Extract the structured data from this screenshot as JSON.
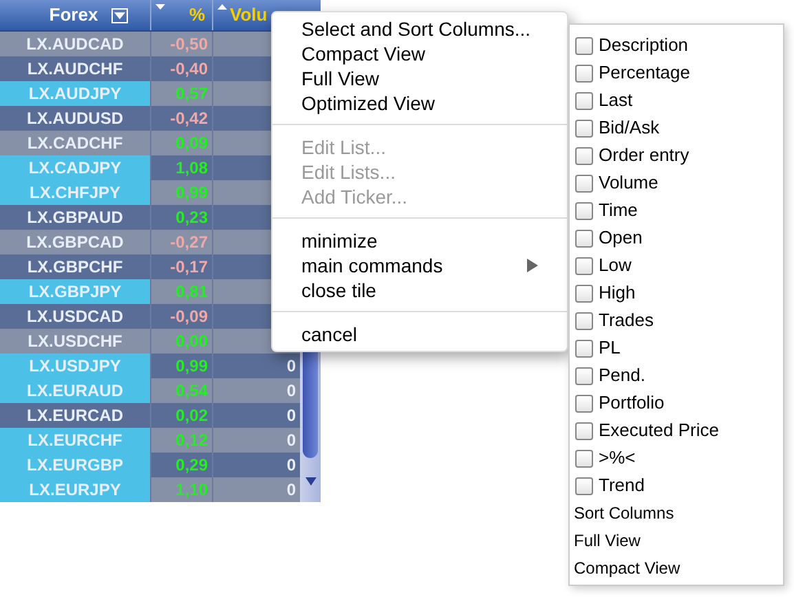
{
  "table": {
    "columns": [
      "Forex",
      "%",
      "Volu"
    ],
    "rows": [
      {
        "symbol": "LX.AUDCAD",
        "percent": "-0,50",
        "negative": true,
        "highlighted": false
      },
      {
        "symbol": "LX.AUDCHF",
        "percent": "-0,40",
        "negative": true,
        "highlighted": false
      },
      {
        "symbol": "LX.AUDJPY",
        "percent": "0,57",
        "negative": false,
        "highlighted": true
      },
      {
        "symbol": "LX.AUDUSD",
        "percent": "-0,42",
        "negative": true,
        "highlighted": false
      },
      {
        "symbol": "LX.CADCHF",
        "percent": "0,09",
        "negative": false,
        "highlighted": false
      },
      {
        "symbol": "LX.CADJPY",
        "percent": "1,08",
        "negative": false,
        "highlighted": true
      },
      {
        "symbol": "LX.CHFJPY",
        "percent": "0,99",
        "negative": false,
        "highlighted": true
      },
      {
        "symbol": "LX.GBPAUD",
        "percent": "0,23",
        "negative": false,
        "highlighted": false
      },
      {
        "symbol": "LX.GBPCAD",
        "percent": "-0,27",
        "negative": true,
        "highlighted": false
      },
      {
        "symbol": "LX.GBPCHF",
        "percent": "-0,17",
        "negative": true,
        "highlighted": false
      },
      {
        "symbol": "LX.GBPJPY",
        "percent": "0,81",
        "negative": false,
        "highlighted": true
      },
      {
        "symbol": "LX.USDCAD",
        "percent": "-0,09",
        "negative": true,
        "highlighted": false
      },
      {
        "symbol": "LX.USDCHF",
        "percent": "0,00",
        "negative": false,
        "highlighted": false
      },
      {
        "symbol": "LX.USDJPY",
        "percent": "0,99",
        "negative": false,
        "highlighted": true,
        "volume": "0"
      },
      {
        "symbol": "LX.EURAUD",
        "percent": "0,54",
        "negative": false,
        "highlighted": true,
        "volume": "0"
      },
      {
        "symbol": "LX.EURCAD",
        "percent": "0,02",
        "negative": false,
        "highlighted": false,
        "volume": "0"
      },
      {
        "symbol": "LX.EURCHF",
        "percent": "0,12",
        "negative": false,
        "highlighted": true,
        "volume": "0"
      },
      {
        "symbol": "LX.EURGBP",
        "percent": "0,29",
        "negative": false,
        "highlighted": true,
        "volume": "0"
      },
      {
        "symbol": "LX.EURJPY",
        "percent": "1,10",
        "negative": false,
        "highlighted": true,
        "volume": "0"
      }
    ]
  },
  "context_menu": {
    "groups": [
      [
        {
          "label": "Select and Sort Columns...",
          "disabled": false
        },
        {
          "label": "Compact View",
          "disabled": false
        },
        {
          "label": "Full View",
          "disabled": false
        },
        {
          "label": "Optimized View",
          "disabled": false
        }
      ],
      [
        {
          "label": "Edit List...",
          "disabled": true
        },
        {
          "label": "Edit Lists...",
          "disabled": true
        },
        {
          "label": "Add Ticker...",
          "disabled": true
        }
      ],
      [
        {
          "label": "minimize",
          "disabled": false
        },
        {
          "label": "main commands",
          "disabled": false,
          "submenu": true
        },
        {
          "label": "close tile",
          "disabled": false
        }
      ],
      [
        {
          "label": "cancel",
          "disabled": false
        }
      ]
    ]
  },
  "submenu": {
    "items": [
      {
        "kind": "checkbox",
        "label": "Description",
        "checked": false
      },
      {
        "kind": "checkbox",
        "label": "Percentage",
        "checked": false
      },
      {
        "kind": "checkbox",
        "label": "Last",
        "checked": false
      },
      {
        "kind": "checkbox",
        "label": "Bid/Ask",
        "checked": false
      },
      {
        "kind": "checkbox",
        "label": "Order entry",
        "checked": false
      },
      {
        "kind": "checkbox",
        "label": "Volume",
        "checked": false
      },
      {
        "kind": "checkbox",
        "label": "Time",
        "checked": false
      },
      {
        "kind": "checkbox",
        "label": "Open",
        "checked": false
      },
      {
        "kind": "checkbox",
        "label": "Low",
        "checked": false
      },
      {
        "kind": "checkbox",
        "label": "High",
        "checked": false
      },
      {
        "kind": "checkbox",
        "label": "Trades",
        "checked": false
      },
      {
        "kind": "checkbox",
        "label": "PL",
        "checked": false
      },
      {
        "kind": "checkbox",
        "label": "Pend.",
        "checked": false
      },
      {
        "kind": "checkbox",
        "label": "Portfolio",
        "checked": false
      },
      {
        "kind": "checkbox",
        "label": "Executed Price",
        "checked": false
      },
      {
        "kind": "checkbox",
        "label": ">%<",
        "checked": false
      },
      {
        "kind": "checkbox",
        "label": "Trend",
        "checked": false
      },
      {
        "kind": "command",
        "label": "Sort Columns"
      },
      {
        "kind": "command",
        "label": "Full View"
      },
      {
        "kind": "command",
        "label": "Compact View"
      }
    ]
  }
}
